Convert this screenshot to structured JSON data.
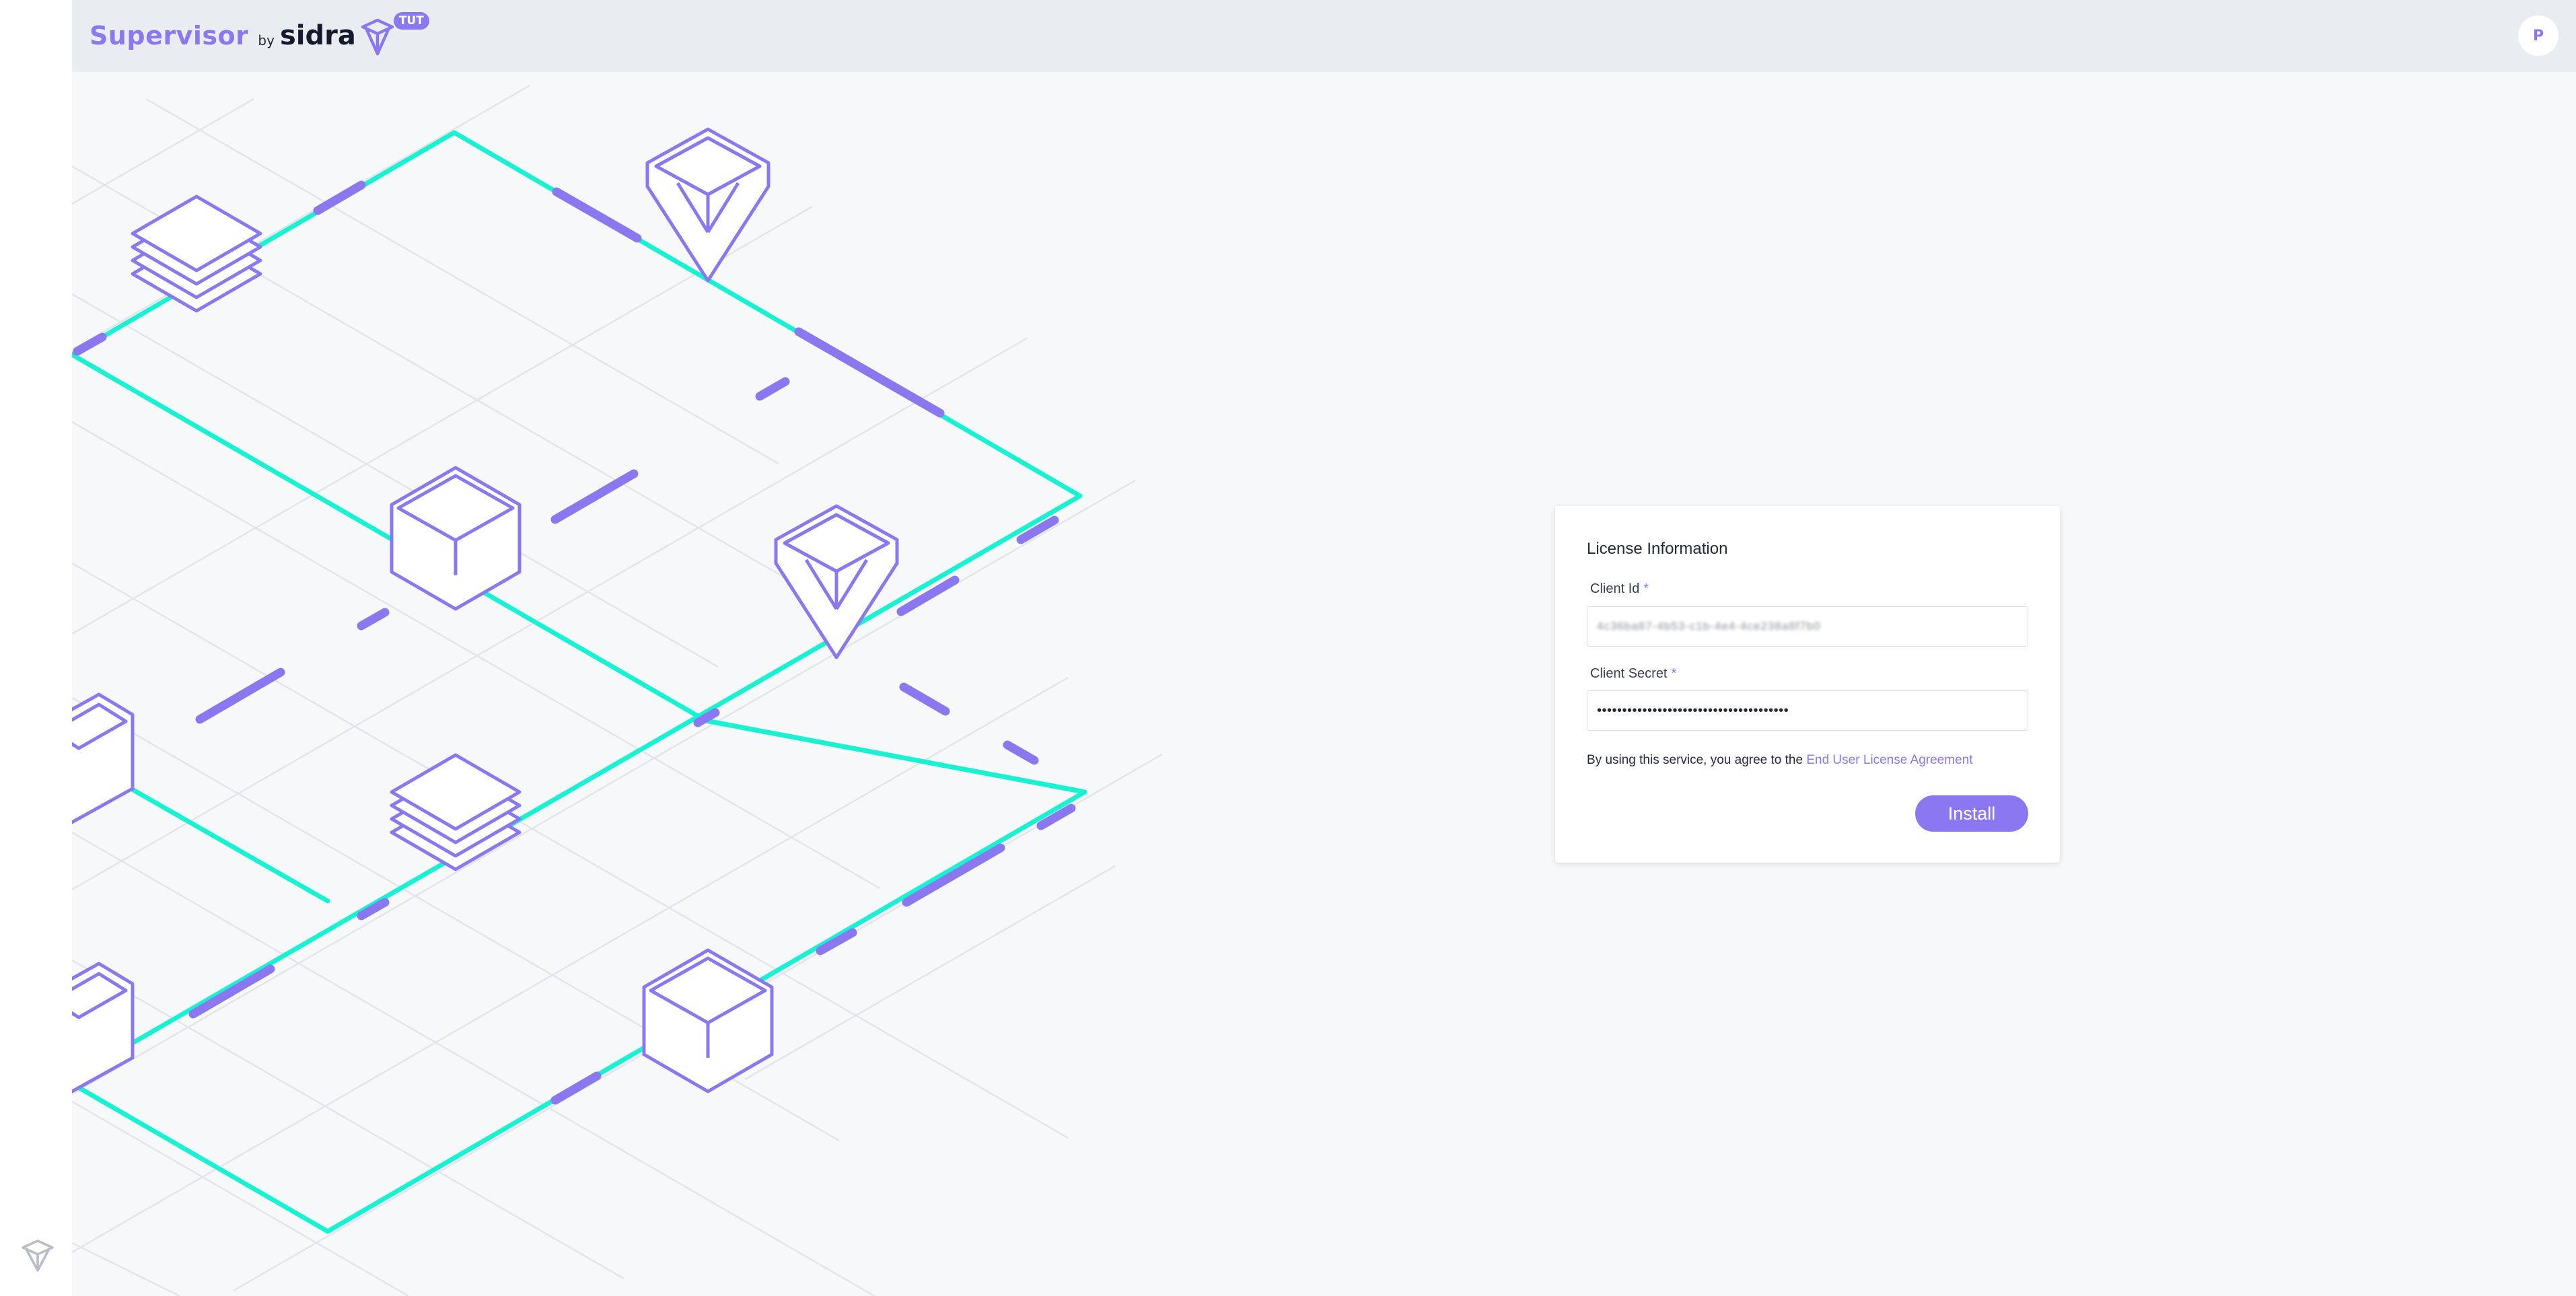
{
  "header": {
    "brand_product": "Supervisor",
    "brand_by": "by",
    "brand_company": "sidra",
    "env_badge": "TUT",
    "avatar_initial": "P"
  },
  "license": {
    "title": "License Information",
    "client_id_label": "Client Id",
    "client_id_value": "4c36ba87-4b53-c1b-4e4-4ce238a8f7b0",
    "client_secret_label": "Client Secret",
    "client_secret_value": "••••••••••••••••••••••••••••••••••••••",
    "required_marker": "*",
    "agreement_prefix": "By using this service, you agree to the",
    "agreement_link": "End User License Agreement",
    "install_label": "Install"
  },
  "colors": {
    "accent": "#8b78f0",
    "teal": "#17f2d2",
    "background": "#f7f8fa",
    "topbar": "#e9ecf1"
  },
  "icons": {
    "brand_mark": "sidra-mark-icon",
    "rail_bottom": "sidra-mark-icon"
  }
}
